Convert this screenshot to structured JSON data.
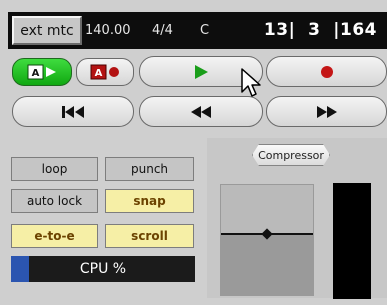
{
  "status_bar": {
    "sync_label": "ext mtc",
    "tempo": "140.00",
    "meter": "4/4",
    "key": "C",
    "position": "13|  3  |164"
  },
  "transport": {
    "row1": [
      {
        "name": "auto-play-button",
        "icon": "auto-play-icon"
      },
      {
        "name": "auto-return-button",
        "icon": "auto-return-icon"
      },
      {
        "name": "play-button",
        "icon": "play-icon"
      },
      {
        "name": "record-button",
        "icon": "record-icon"
      }
    ],
    "row2": [
      {
        "name": "goto-start-button",
        "icon": "goto-start-icon"
      },
      {
        "name": "rewind-button",
        "icon": "rewind-icon"
      },
      {
        "name": "fast-forward-button",
        "icon": "fast-forward-icon"
      }
    ]
  },
  "options": {
    "loop": {
      "label": "loop",
      "active": false
    },
    "punch": {
      "label": "punch",
      "active": false
    },
    "auto_lock": {
      "label": "auto lock",
      "active": false
    },
    "snap": {
      "label": "snap",
      "active": true
    },
    "e_to_e": {
      "label": "e-to-e",
      "active": true
    },
    "scroll": {
      "label": "scroll",
      "active": true
    }
  },
  "cpu": {
    "label": "CPU %",
    "fraction": 0.1
  },
  "plugin": {
    "name": "Compressor",
    "fader_fraction": 0.55
  },
  "colors": {
    "status_bg": "#0d0d0d",
    "active_green": "#22c222",
    "play_green": "#1a9e1a",
    "record_red": "#c41616",
    "option_active": "#f6efa6",
    "cpu_fill": "#2b55b0"
  }
}
